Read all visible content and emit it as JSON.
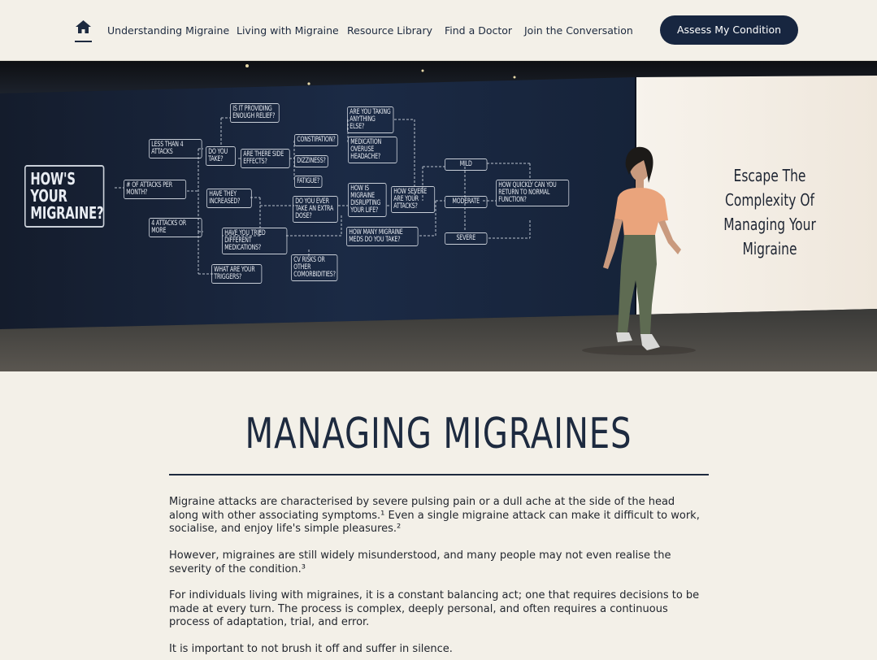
{
  "nav": {
    "home_icon": "home-icon",
    "links": [
      "Understanding Migraine",
      "Living with Migraine",
      "Resource Library",
      "Find a Doctor",
      "Join the Conversation"
    ],
    "cta_label": "Assess My Condition"
  },
  "hero": {
    "tagline_line1": "Escape The Complexity Of",
    "tagline_line2": "Managing Your Migraine",
    "flowchart": {
      "main": "HOW'S YOUR MIGRAINE?",
      "attacks_per_month": "# OF ATTACKS PER MONTH?",
      "less_than_4": "LESS THAN 4 ATTACKS",
      "four_or_more": "4 ATTACKS OR MORE",
      "do_you_take": "DO YOU TAKE?",
      "enough_relief": "IS IT PROVIDING ENOUGH RELIEF?",
      "side_effects": "ARE THERE SIDE EFFECTS?",
      "constipation": "CONSTIPATION?",
      "dizziness": "DIZZINESS?",
      "fatigue": "FATIGUE?",
      "have_they_increased": "HAVE THEY INCREASED?",
      "extra_dose": "DO YOU EVER TAKE AN EXTRA DOSE?",
      "tried_different": "HAVE YOU TRIED DIFFERENT MEDICATIONS?",
      "cv_risks": "CV RISKS OR OTHER COMORBIDITIES?",
      "triggers": "WHAT ARE YOUR TRIGGERS?",
      "anything_else": "ARE YOU TAKING ANYTHING ELSE?",
      "medication_overuse": "MEDICATION OVERUSE HEADACHE?",
      "disrupting": "HOW IS MIGRAINE DISRUPTING YOUR LIFE?",
      "how_many_meds": "HOW MANY MIGRAINE MEDS DO YOU TAKE?",
      "how_severe": "HOW SEVERE ARE YOUR ATTACKS?",
      "mild": "MILD",
      "moderate": "MODERATE",
      "severe": "SEVERE",
      "return_function": "HOW QUICKLY CAN YOU RETURN TO NORMAL FUNCTION?"
    }
  },
  "content": {
    "title": "MANAGING MIGRAINES",
    "p1_l1": "Migraine attacks are characterised by severe pulsing pain or a dull ache at the side of the head",
    "p1_l2": "along with other associating symptoms.¹ Even a single migraine attack can make it difficult to work,",
    "p1_l3": "socialise, and enjoy life's simple pleasures.²",
    "p2_l1": "However, migraines are still widely misunderstood, and many people may not even realise the",
    "p2_l2": "severity of the condition.³",
    "p3_l1": "For individuals living with migraines, it is a constant balancing act; one that requires decisions to be",
    "p3_l2": "made at every turn. The process is complex, deeply personal, and often requires a continuous",
    "p3_l3": "process of adaptation, trial, and error.",
    "p4_l1": "It is important to not brush it off and suffer in silence."
  },
  "colors": {
    "page_bg": "#f3f0e8",
    "navy": "#172640",
    "text": "#1d2a3f"
  }
}
